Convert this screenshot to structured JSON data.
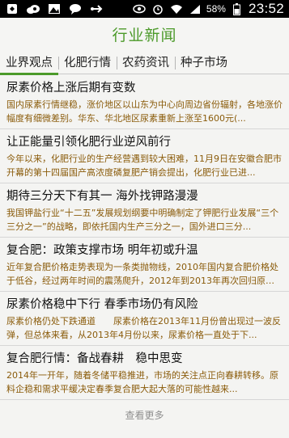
{
  "status_bar": {
    "battery_percent": "58%",
    "time": "23:52",
    "icons": [
      "notification-icon",
      "cloud-icon",
      "image-icon",
      "chat-icon",
      "usb-icon",
      "eye-icon",
      "alarm-icon",
      "wifi-icon",
      "signal-icon",
      "battery-icon"
    ]
  },
  "header": {
    "title": "行业新闻"
  },
  "tabs": [
    {
      "label": "业界观点",
      "active": true
    },
    {
      "label": "化肥行情",
      "active": false
    },
    {
      "label": "农药资讯",
      "active": false
    },
    {
      "label": "种子市场",
      "active": false
    }
  ],
  "news": [
    {
      "title": "尿素价格上涨后期有变数",
      "summary": "国内尿素行情继稳，涨价地区以山东为中心向周边省份辐射，各地涨价幅度有细微差别。华东、华北地区尿素重新上涨至1600元(..."
    },
    {
      "title": "让正能量引领化肥行业逆风前行",
      "summary": "今年以来，化肥行业的生产经营遇到较大困难，11月9日在安徽合肥市开幕的第十四届国产高浓度磷复肥产销会提出，化肥行业已进..."
    },
    {
      "title": "期待三分天下有其一 海外找钾路漫漫",
      "summary": "我国钾盐行业“十二五”发展规划纲要中明确制定了钾肥行业发展“三个三分之一”的战略，即依托国内生产三分之一，国外进口三分..."
    },
    {
      "title": "复合肥：政策支撑市场 明年初或升温",
      "summary": "近年复合肥价格走势表现为一条类抛物线，2010年国内复合肥价格处于低谷，经过两年时间的震荡爬升，2012年到2013年再次回归原点。..."
    },
    {
      "title": "尿素价格稳中下行 春季市场仍有风险",
      "summary": "尿素价格仍处下跌通道　　尿素价格在2013年11月份曾出现过一波反弹，但总体来看，从2013年4月份以来，尿素价格一直处于下..."
    },
    {
      "title": "复合肥行情：备战春耕　稳中思变",
      "summary": "2014年一开年，随着冬储平稳推进，市场的关注点正向春耕转移。原料企稳和需求平缓决定春季复合肥大起大落的可能性越来..."
    }
  ],
  "load_more": "查看更多",
  "colors": {
    "accent": "#4c9a2a",
    "summary": "#8a5b0a"
  }
}
